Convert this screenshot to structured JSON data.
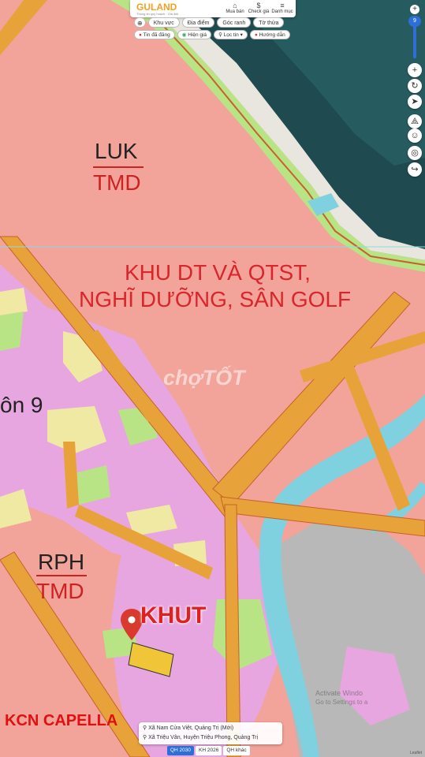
{
  "app": {
    "logo": "GULAND",
    "logo_tagline": "Thông tin quy hoạch · Giá đất"
  },
  "toolbar": {
    "items": [
      {
        "label": "Mua bán",
        "icon": "home-icon"
      },
      {
        "label": "Check giá",
        "icon": "dollar-icon"
      },
      {
        "label": "Danh mục",
        "icon": "menu-icon"
      }
    ]
  },
  "tabs": {
    "locate_icon": "target-icon",
    "items": [
      "Khu vực",
      "Địa điểm",
      "Góc ranh",
      "Tờ thửa"
    ]
  },
  "filters": {
    "items": [
      "Tin đã đăng",
      "Hiện giá",
      "Lọc tin ▾",
      "Hướng dẫn"
    ]
  },
  "controls": {
    "zoom_value": "9",
    "plus": "+",
    "minus": "−"
  },
  "map": {
    "labels": {
      "luk": "LUK",
      "tmd_top": "TMD",
      "zone_line1": "KHU DT VÀ QTST,",
      "zone_line2": "NGHĨ DƯỠNG, SÂN GOLF",
      "watermark": "chợTỐT",
      "thon": "ôn 9",
      "rph": "RPH",
      "tmd_bottom": "TMD",
      "khut": "KHUT",
      "kcn": "KCN CAPELLA",
      "activate_line1": "Activate Windo",
      "activate_line2": "Go to Settings to a"
    },
    "colors": {
      "land_pink": "#f2a39a",
      "road_orange": "#e8a23a",
      "road_border": "#c7612b",
      "residential": "#e7a6e0",
      "water_blue": "#7fd1e0",
      "sea": "#1e4a4e",
      "grass_green": "#b8e486",
      "gray_area": "#b8b8b8",
      "yellow": "#efe9a4"
    }
  },
  "address": {
    "line1": "Xã Nam Cửa Việt, Quảng Trị (Mới)",
    "line2": "Xã Triệu Vân, Huyện Triệu Phong, Quảng Trị"
  },
  "plan_tabs": {
    "items": [
      "QH 2030",
      "KH 2026",
      "QH khác"
    ],
    "active": "QH 2030"
  },
  "attribution": "Leaflet"
}
